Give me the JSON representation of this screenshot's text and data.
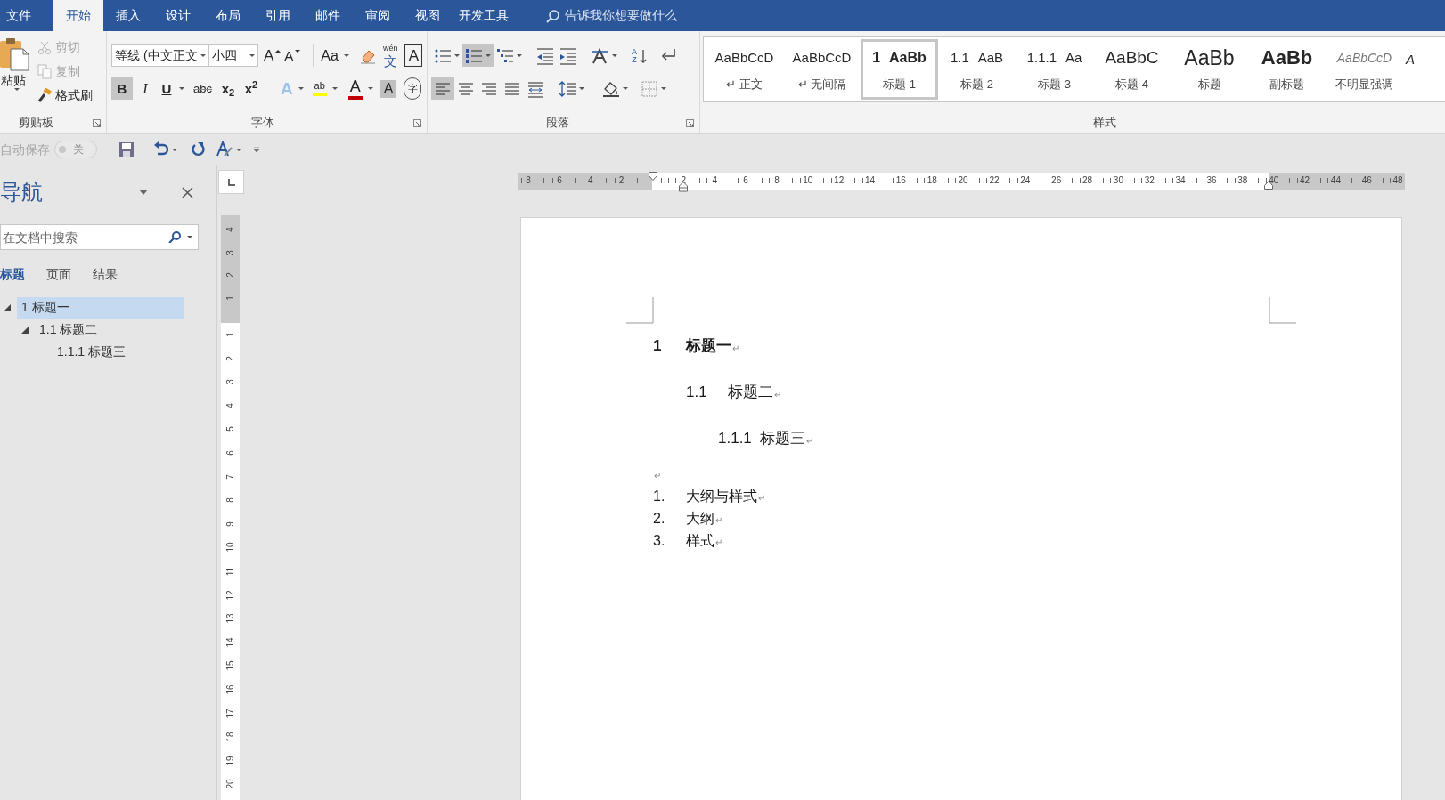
{
  "title_bar": {
    "tabs": [
      {
        "label": "文件",
        "selected": false
      },
      {
        "label": "开始",
        "selected": true
      },
      {
        "label": "插入",
        "selected": false
      },
      {
        "label": "设计",
        "selected": false
      },
      {
        "label": "布局",
        "selected": false
      },
      {
        "label": "引用",
        "selected": false
      },
      {
        "label": "邮件",
        "selected": false
      },
      {
        "label": "审阅",
        "selected": false
      },
      {
        "label": "视图",
        "selected": false
      },
      {
        "label": "开发工具",
        "selected": false
      }
    ],
    "tell_me": "告诉我你想要做什么"
  },
  "ribbon": {
    "clipboard": {
      "label": "剪贴板",
      "paste": "粘贴",
      "commands": [
        {
          "kind": "cut",
          "label": "剪切",
          "disabled": true
        },
        {
          "kind": "copy",
          "label": "复制",
          "disabled": true
        },
        {
          "kind": "format_painter",
          "label": "格式刷",
          "disabled": false
        }
      ]
    },
    "font": {
      "label": "字体",
      "font_name": "等线 (中文正文",
      "font_size": "小四",
      "row1": [
        {
          "kind": "grow",
          "glyph": "A",
          "selected": false
        },
        {
          "kind": "shrink",
          "glyph": "A",
          "selected": false
        },
        {
          "kind": "case",
          "glyph": "Aa",
          "selected": false
        },
        {
          "kind": "clear",
          "selected": false
        },
        {
          "kind": "phonetic",
          "glyph": "文",
          "ruby": "wén",
          "selected": false
        },
        {
          "kind": "border",
          "glyph": "A",
          "selected": false
        }
      ],
      "row2": [
        {
          "kind": "bold",
          "glyph": "B",
          "selected": true
        },
        {
          "kind": "italic",
          "glyph": "I",
          "selected": false
        },
        {
          "kind": "underline",
          "glyph": "U",
          "selected": false
        },
        {
          "kind": "strike",
          "glyph": "abc",
          "selected": false
        },
        {
          "kind": "subscript",
          "glyph": "x$_{2}$",
          "selected": false
        },
        {
          "kind": "superscript",
          "glyph": "x$^{2}$",
          "selected": false
        },
        {
          "kind": "effects",
          "glyph": "A",
          "selected": false
        },
        {
          "kind": "highlight",
          "glyph": "ab",
          "selected": false
        },
        {
          "kind": "font_color",
          "glyph": "A",
          "selected": false
        },
        {
          "kind": "shading",
          "glyph": "A",
          "selected": false
        },
        {
          "kind": "enclose",
          "glyph": "字",
          "selected": false
        }
      ]
    },
    "paragraph": {
      "label": "段落",
      "row1": [
        {
          "kind": "bullets",
          "selected": false
        },
        {
          "kind": "numbering",
          "selected": true
        },
        {
          "kind": "multilevel",
          "selected": false
        },
        {
          "kind": "decrease_indent",
          "selected": false
        },
        {
          "kind": "increase_indent",
          "selected": false
        },
        {
          "kind": "asian_layout",
          "selected": false
        },
        {
          "kind": "sort",
          "glyphs": [
            "A",
            "Z"
          ],
          "selected": false
        },
        {
          "kind": "show_marks",
          "selected": false
        }
      ],
      "row2": [
        {
          "kind": "align_left",
          "selected": true
        },
        {
          "kind": "align_center",
          "selected": false
        },
        {
          "kind": "align_right",
          "selected": false
        },
        {
          "kind": "justify",
          "selected": false
        },
        {
          "kind": "distribute",
          "selected": false
        },
        {
          "kind": "line_spacing",
          "selected": false
        },
        {
          "kind": "shading",
          "selected": false
        },
        {
          "kind": "borders",
          "selected": false
        }
      ]
    },
    "styles": {
      "label": "样式",
      "items": [
        {
          "kind": "normal",
          "preview": "AaBbCcD",
          "name": "↵ 正文",
          "selected": false
        },
        {
          "kind": "no_spacing",
          "preview": "AaBbCcD",
          "name": "↵ 无间隔",
          "selected": false
        },
        {
          "kind": "heading1",
          "number": "1",
          "preview": "AaBb",
          "name": "标题 1",
          "selected": true
        },
        {
          "kind": "heading2",
          "number": "1.1",
          "preview": "AaB",
          "name": "标题 2",
          "selected": false
        },
        {
          "kind": "heading3",
          "number": "1.1.1",
          "preview": "Aa",
          "name": "标题 3",
          "selected": false
        },
        {
          "kind": "heading4",
          "preview": "AaBbC",
          "name": "标题 4",
          "selected": false
        },
        {
          "kind": "title",
          "preview": "AaBb",
          "name": "标题",
          "selected": false
        },
        {
          "kind": "subtitle",
          "preview": "AaBb",
          "name": "副标题",
          "selected": false
        },
        {
          "kind": "subtle_emphasis",
          "preview": "AaBbCcD",
          "name": "不明显强调",
          "selected": false
        },
        {
          "kind": "emphasis",
          "preview": "A",
          "selected": false
        }
      ]
    }
  },
  "quick_access": {
    "autosave": "自动保存",
    "autosave_on": false,
    "autosave_state": "关"
  },
  "navigation": {
    "title": "导航",
    "search_placeholder": "在文档中搜索",
    "tabs": [
      {
        "label": "标题",
        "selected": true
      },
      {
        "label": "页面",
        "selected": false
      },
      {
        "label": "结果",
        "selected": false
      }
    ],
    "tree": [
      {
        "label": "1 标题一",
        "selected": true,
        "expanded": true,
        "children": [
          {
            "label": "1.1 标题二",
            "selected": false,
            "expanded": true,
            "children": [
              {
                "label": "1.1.1 标题三",
                "selected": false
              }
            ]
          }
        ]
      }
    ]
  },
  "ruler": {
    "left_labels": [
      "8",
      "6",
      "4",
      "2"
    ],
    "labels": [
      "2",
      "4",
      "6",
      "8",
      "10",
      "12",
      "14",
      "16",
      "18",
      "20",
      "22",
      "24",
      "26",
      "28",
      "30",
      "32",
      "34",
      "36",
      "38",
      "40",
      "42",
      "44",
      "46",
      "48"
    ],
    "vertical_top_labels": [
      "4",
      "3",
      "2",
      "1"
    ],
    "vertical_labels": [
      "1",
      "2",
      "3",
      "4",
      "5",
      "6",
      "7",
      "8",
      "9",
      "10",
      "11",
      "12",
      "13",
      "14",
      "15",
      "16",
      "17",
      "18",
      "19",
      "20"
    ]
  },
  "document": {
    "paragraphs": [
      {
        "kind": "heading1",
        "number": "1",
        "text": "标题一",
        "end_mark": "↵"
      },
      {
        "kind": "heading2",
        "number": "1.1",
        "text": "标题二",
        "end_mark": "↵"
      },
      {
        "kind": "heading3",
        "number": "1.1.1",
        "text": "标题三",
        "end_mark": "↵"
      },
      {
        "kind": "empty",
        "end_mark": "↵"
      },
      {
        "kind": "list",
        "number": "1.",
        "text": "大纲与样式",
        "end_mark": "↵"
      },
      {
        "kind": "list",
        "number": "2.",
        "text": "大纲",
        "end_mark": "↵"
      },
      {
        "kind": "list",
        "number": "3.",
        "text": "样式",
        "end_mark": "↵"
      }
    ]
  }
}
